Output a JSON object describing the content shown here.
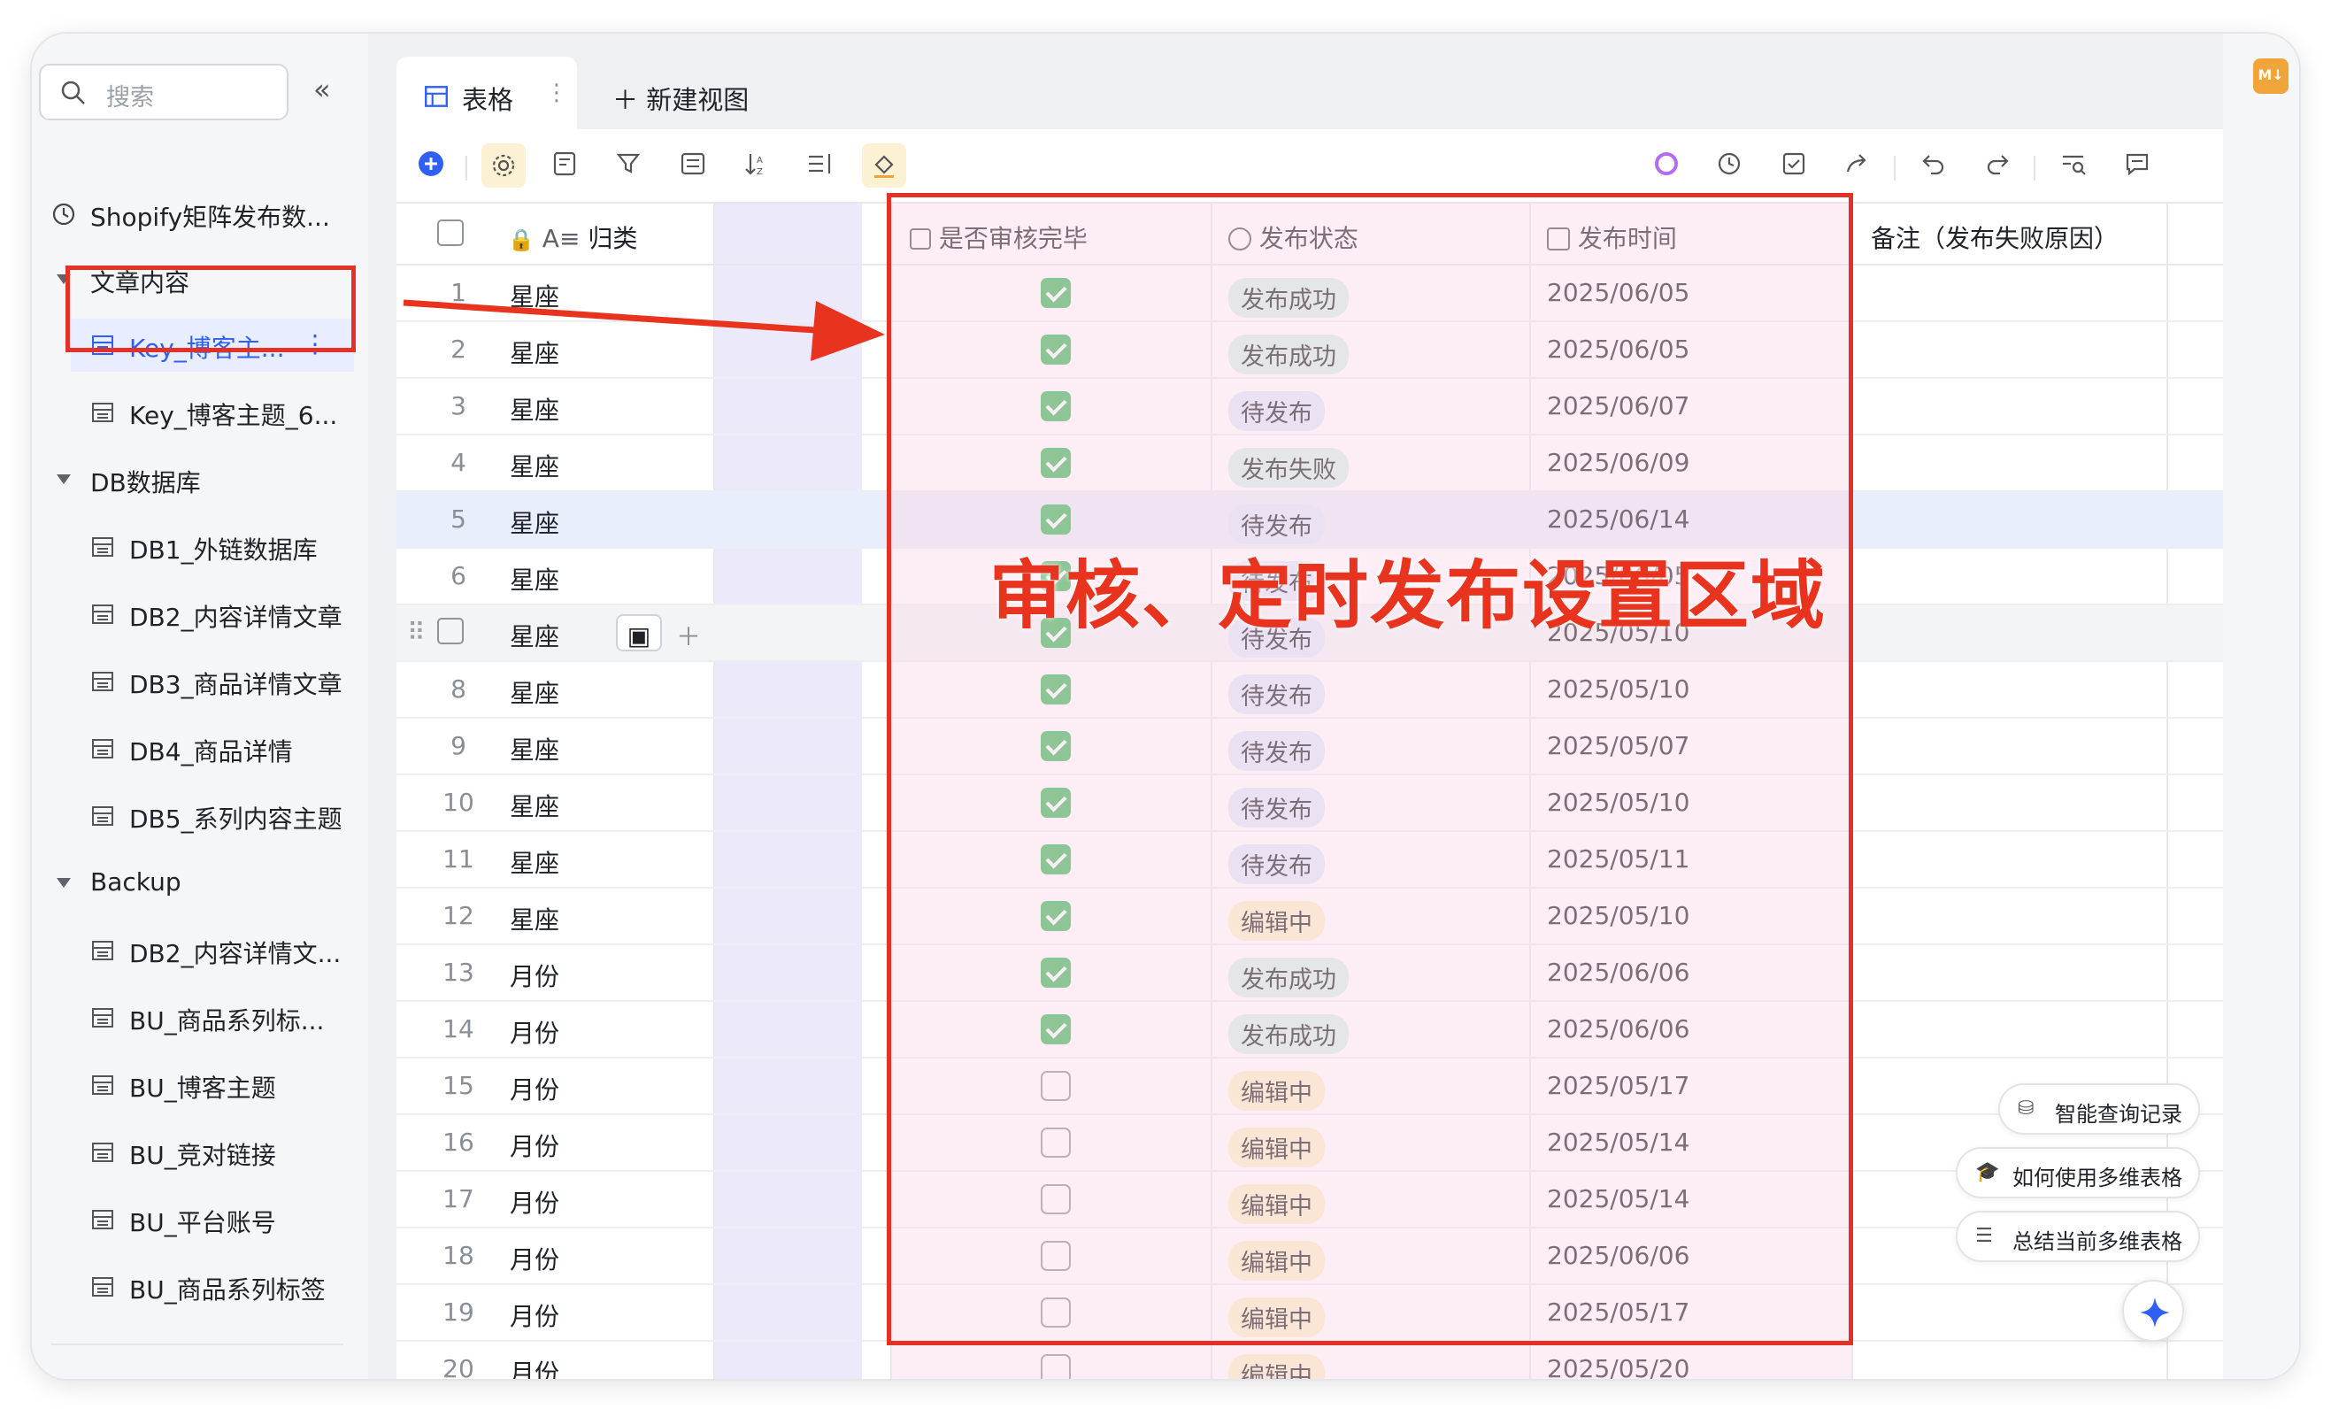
{
  "sidebar": {
    "search_placeholder": "搜索",
    "top_item": "Shopify矩阵发布数...",
    "groups": [
      {
        "label": "文章内容",
        "items": [
          "Key_博客主...",
          "Key_博客主题_6..."
        ]
      },
      {
        "label": "DB数据库",
        "items": [
          "DB1_外链数据库",
          "DB2_内容详情文章",
          "DB3_商品详情文章",
          "DB4_商品详情",
          "DB5_系列内容主题"
        ]
      },
      {
        "label": "Backup",
        "items": [
          "DB2_内容详情文...",
          "BU_商品系列标...",
          "BU_博客主题",
          "BU_竞对链接",
          "BU_平台账号",
          "BU_商品系列标签"
        ]
      }
    ]
  },
  "tabs": {
    "active": "表格",
    "new_view": "新建视图"
  },
  "columns": {
    "category": "归类",
    "reviewed": "是否审核完毕",
    "status": "发布状态",
    "time": "发布时间",
    "note": "备注（发布失败原因）"
  },
  "rows": [
    {
      "n": "1",
      "cat": "星座",
      "checked": true,
      "status": "发布成功",
      "date": "2025/06/05"
    },
    {
      "n": "2",
      "cat": "星座",
      "checked": true,
      "status": "发布成功",
      "date": "2025/06/05"
    },
    {
      "n": "3",
      "cat": "星座",
      "checked": true,
      "status": "待发布",
      "date": "2025/06/07"
    },
    {
      "n": "4",
      "cat": "星座",
      "checked": true,
      "status": "发布失败",
      "date": "2025/06/09"
    },
    {
      "n": "5",
      "cat": "星座",
      "checked": true,
      "status": "待发布",
      "date": "2025/06/14"
    },
    {
      "n": "6",
      "cat": "星座",
      "checked": true,
      "status": "待发布",
      "date": "2025/06/05"
    },
    {
      "n": "",
      "cat": "星座",
      "checked": true,
      "status": "待发布",
      "date": "2025/05/10"
    },
    {
      "n": "8",
      "cat": "星座",
      "checked": true,
      "status": "待发布",
      "date": "2025/05/10"
    },
    {
      "n": "9",
      "cat": "星座",
      "checked": true,
      "status": "待发布",
      "date": "2025/05/07"
    },
    {
      "n": "10",
      "cat": "星座",
      "checked": true,
      "status": "待发布",
      "date": "2025/05/10"
    },
    {
      "n": "11",
      "cat": "星座",
      "checked": true,
      "status": "待发布",
      "date": "2025/05/11"
    },
    {
      "n": "12",
      "cat": "星座",
      "checked": true,
      "status": "编辑中",
      "date": "2025/05/10"
    },
    {
      "n": "13",
      "cat": "月份",
      "checked": true,
      "status": "发布成功",
      "date": "2025/06/06"
    },
    {
      "n": "14",
      "cat": "月份",
      "checked": true,
      "status": "发布成功",
      "date": "2025/06/06"
    },
    {
      "n": "15",
      "cat": "月份",
      "checked": false,
      "status": "编辑中",
      "date": "2025/05/17"
    },
    {
      "n": "16",
      "cat": "月份",
      "checked": false,
      "status": "编辑中",
      "date": "2025/05/14"
    },
    {
      "n": "17",
      "cat": "月份",
      "checked": false,
      "status": "编辑中",
      "date": "2025/05/14"
    },
    {
      "n": "18",
      "cat": "月份",
      "checked": false,
      "status": "编辑中",
      "date": "2025/06/06"
    },
    {
      "n": "19",
      "cat": "月份",
      "checked": false,
      "status": "编辑中",
      "date": "2025/05/17"
    },
    {
      "n": "20",
      "cat": "月份",
      "checked": false,
      "status": "编辑中",
      "date": "2025/05/20"
    }
  ],
  "status_colors": {
    "发布成功": {
      "bg": "#d6f2ec",
      "fg": "#1f2329"
    },
    "待发布": {
      "bg": "#dfe9fb",
      "fg": "#1f2329"
    },
    "发布失败": {
      "bg": "#d6f2ec",
      "fg": "#1f2329"
    },
    "编辑中": {
      "bg": "#fbf0c9",
      "fg": "#1f2329"
    }
  },
  "annotation": {
    "text": "审核、定时发布设置区域",
    "color": "#e8331e"
  },
  "floating": {
    "smart_query": "智能查询记录",
    "how_to": "如何使用多维表格",
    "summarize": "总结当前多维表格"
  },
  "corner_badge": "M↓"
}
